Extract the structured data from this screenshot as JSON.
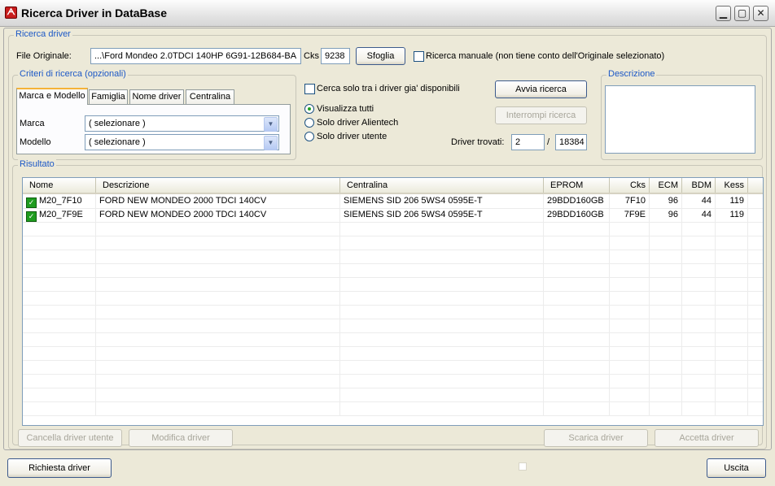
{
  "window": {
    "title": "Ricerca Driver in DataBase",
    "app_icon": "driver-db-icon"
  },
  "ricerca_driver": {
    "legend": "Ricerca driver",
    "file_label": "File Originale:",
    "file_value": "...\\Ford Mondeo  2.0TDCI 140HP 6G91-12B684-BA",
    "cks_label": "Cks",
    "cks_value": "9238",
    "browse_label": "Sfoglia",
    "manual_label": "Ricerca manuale (non tiene conto dell'Originale selezionato)"
  },
  "criteri": {
    "legend": "Criteri di ricerca (opzionali)",
    "tabs": [
      "Marca e Modello",
      "Famiglia",
      "Nome driver",
      "Centralina"
    ],
    "marca_label": "Marca",
    "marca_value": "( selezionare )",
    "modello_label": "Modello",
    "modello_value": "( selezionare )"
  },
  "options": {
    "only_available_label": "Cerca solo tra i driver gia' disponibili",
    "radio_all": "Visualizza tutti",
    "radio_alientech": "Solo driver Alientech",
    "radio_user": "Solo driver utente",
    "selected": "Visualizza tutti"
  },
  "search": {
    "start_label": "Avvia ricerca",
    "stop_label": "Interrompi ricerca",
    "found_label": "Driver trovati:",
    "found_value": "2",
    "slash": "/",
    "total_value": "18384"
  },
  "descrizione": {
    "legend": "Descrizione"
  },
  "risultato": {
    "legend": "Risultato",
    "columns": [
      "Nome",
      "Descrizione",
      "Centralina",
      "EPROM",
      "Cks",
      "ECM",
      "BDM",
      "Kess"
    ],
    "rows": [
      {
        "nome": "M20_7F10",
        "descrizione": "FORD NEW MONDEO 2000 TDCI 140CV",
        "centralina": "SIEMENS SID 206 5WS4 0595E-T",
        "eprom": "29BDD160GB",
        "cks": "7F10",
        "ecm": "96",
        "bdm": "44",
        "kess": "119"
      },
      {
        "nome": "M20_7F9E",
        "descrizione": "FORD NEW MONDEO 2000 TDCI 140CV",
        "centralina": "SIEMENS SID 206 5WS4 0595E-T",
        "eprom": "29BDD160GB",
        "cks": "7F9E",
        "ecm": "96",
        "bdm": "44",
        "kess": "119"
      }
    ],
    "delete_label": "Cancella driver utente",
    "edit_label": "Modifica driver",
    "download_label": "Scarica driver",
    "accept_label": "Accetta driver"
  },
  "footer": {
    "request_label": "Richiesta driver",
    "exit_label": "Uscita"
  },
  "colors": {
    "legend": "#1c58c6",
    "accent_tab": "#f5b338",
    "check_green": "#1f9c1f"
  }
}
